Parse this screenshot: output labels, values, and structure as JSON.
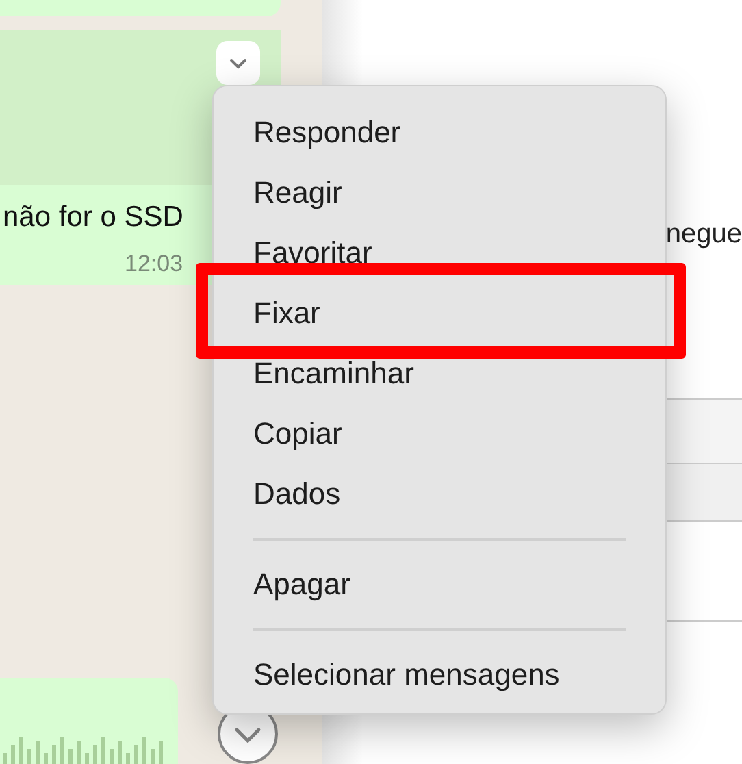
{
  "chat": {
    "message": {
      "text": "não for o SSD",
      "time": "12:03"
    }
  },
  "side_panel": {
    "text": "negue"
  },
  "context_menu": {
    "groups": [
      {
        "items": [
          {
            "label": "Responder",
            "highlighted": false
          },
          {
            "label": "Reagir",
            "highlighted": false
          },
          {
            "label": "Favoritar",
            "highlighted": false
          },
          {
            "label": "Fixar",
            "highlighted": true
          },
          {
            "label": "Encaminhar",
            "highlighted": false
          },
          {
            "label": "Copiar",
            "highlighted": false
          },
          {
            "label": "Dados",
            "highlighted": false
          }
        ]
      },
      {
        "items": [
          {
            "label": "Apagar",
            "highlighted": false
          }
        ]
      },
      {
        "items": [
          {
            "label": "Selecionar mensagens",
            "highlighted": false
          }
        ]
      }
    ]
  }
}
